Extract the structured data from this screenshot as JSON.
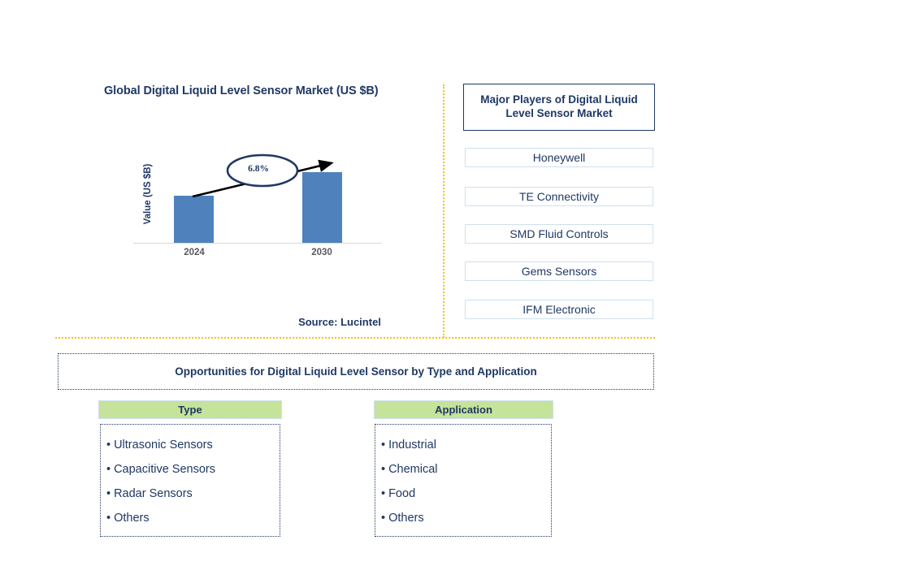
{
  "chart": {
    "title": "Global Digital Liquid Level Sensor Market (US $B)",
    "y_axis_label": "Value (US $B)",
    "cagr_label": "6.8%",
    "source": "Source: Lucintel"
  },
  "chart_data": {
    "type": "bar",
    "title": "Global Digital Liquid Level Sensor Market (US $B)",
    "categories": [
      "2024",
      "2030"
    ],
    "values": [
      58,
      87
    ],
    "xlabel": "",
    "ylabel": "Value (US $B)",
    "annotation": "6.8%",
    "annotation_note": "CAGR arrow from 2024 bar to 2030 bar",
    "grid": false,
    "legend": "none",
    "bar_color": "#4f81bd",
    "axis_color": "#d9d9d9"
  },
  "players": {
    "header": "Major Players of Digital Liquid Level Sensor Market",
    "items": [
      {
        "name": "Honeywell"
      },
      {
        "name": "TE Connectivity"
      },
      {
        "name": "SMD Fluid Controls"
      },
      {
        "name": "Gems Sensors"
      },
      {
        "name": "IFM Electronic"
      }
    ]
  },
  "opportunities": {
    "banner": "Opportunities for Digital Liquid Level Sensor by Type and Application",
    "segments": [
      {
        "header": "Type",
        "items": [
          "Ultrasonic Sensors",
          "Capacitive Sensors",
          "Radar Sensors",
          "Others"
        ]
      },
      {
        "header": "Application",
        "items": [
          "Industrial",
          "Chemical",
          "Food",
          "Others"
        ]
      }
    ]
  },
  "colors": {
    "navy": "#1f3864",
    "bar_blue": "#4f81bd",
    "gold_divider": "#ffc000",
    "green_header": "#c5e39a",
    "light_blue_border": "#cfe0ee"
  },
  "bullet": "•"
}
